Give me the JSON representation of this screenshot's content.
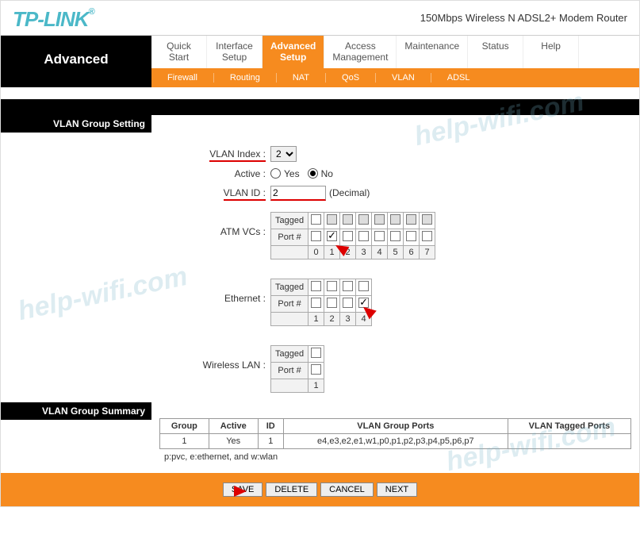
{
  "header": {
    "logo_text": "TP-LINK",
    "logo_reg": "®",
    "product": "150Mbps Wireless N ADSL2+ Modem Router"
  },
  "nav": {
    "current_section": "Advanced",
    "main_tabs": [
      "Quick\nStart",
      "Interface\nSetup",
      "Advanced\nSetup",
      "Access\nManagement",
      "Maintenance",
      "Status",
      "Help"
    ],
    "active_main_index": 2,
    "sub_tabs": [
      "Firewall",
      "Routing",
      "NAT",
      "QoS",
      "VLAN",
      "ADSL"
    ]
  },
  "section1_title": "VLAN Group Setting",
  "form": {
    "vlan_index_label": "VLAN Index :",
    "vlan_index_value": "2",
    "active_label": "Active :",
    "active_yes": "Yes",
    "active_no": "No",
    "active_selected": "No",
    "vlan_id_label": "VLAN ID :",
    "vlan_id_value": "2",
    "vlan_id_suffix": "(Decimal)",
    "atm_label": "ATM VCs :",
    "eth_label": "Ethernet :",
    "wlan_label": "Wireless LAN :",
    "row_tagged": "Tagged",
    "row_port": "Port #",
    "atm_ports": [
      "0",
      "1",
      "2",
      "3",
      "4",
      "5",
      "6",
      "7"
    ],
    "atm_port_checked_index": 1,
    "eth_ports": [
      "1",
      "2",
      "3",
      "4"
    ],
    "eth_port_checked_index": 3,
    "wlan_ports": [
      "1"
    ]
  },
  "section2_title": "VLAN Group Summary",
  "summary": {
    "cols": [
      "Group",
      "Active",
      "ID",
      "VLAN Group Ports",
      "VLAN Tagged Ports"
    ],
    "rows": [
      {
        "group": "1",
        "active": "Yes",
        "id": "1",
        "ports": "e4,e3,e2,e1,w1,p0,p1,p2,p3,p4,p5,p6,p7",
        "tagged": ""
      }
    ],
    "legend": "p:pvc, e:ethernet, and w:wlan"
  },
  "buttons": {
    "save": "SAVE",
    "delete": "DELETE",
    "cancel": "CANCEL",
    "next": "NEXT"
  },
  "watermark": "help-wifi.com"
}
